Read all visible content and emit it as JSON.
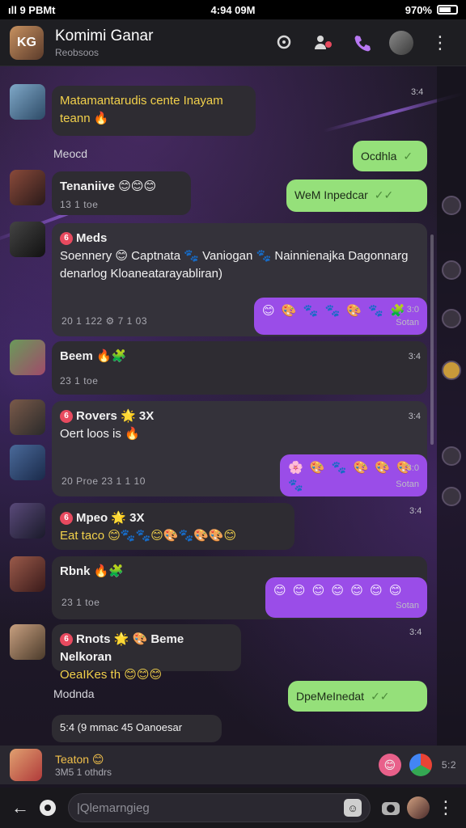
{
  "status": {
    "left": "ıll 9 PBMt",
    "time": "4:94 09M",
    "battery": "970%"
  },
  "header": {
    "title": "Komimi Ganar",
    "subtitle": "Reobsoos",
    "avatar_initials": "KG"
  },
  "messages": {
    "m1": {
      "text": "Matamantarudis cente Inayam",
      "text2": "teann 🔥",
      "time": "3:4"
    },
    "label1": "Meocd",
    "m2": {
      "text": "Ocdhla"
    },
    "m3": {
      "sender": "Tenaniive 😊😊😊",
      "meta": "13 1 toe"
    },
    "m4": {
      "text": "WeM Inpedcar"
    },
    "m5": {
      "sender": "Meds",
      "line1": "Soennery 😊 Captnata 🐾 Vaniogan 🐾 Nainnienajka Dagonnarg",
      "line2": "denarlog Kloaneatarayabliran)",
      "meta": "20 1 122   ⚙ 7 1 03"
    },
    "m6": {
      "emojis": "😊 🎨 🐾 🐾 🎨 🐾 🧩",
      "time": "3:0",
      "note": "Sotan"
    },
    "m7": {
      "sender": "Beem 🔥🧩",
      "meta": "23 1 toe",
      "time": "3:4"
    },
    "m8": {
      "sender": "Rovers 🌟 3X",
      "line1": "Oert loos is   🔥",
      "time": "3:4"
    },
    "m9": {
      "emojis": "🌸 🎨 🐾 🎨 🎨 🎨 🐾",
      "time": "3:0",
      "note": "Sotan",
      "meta": "20 Proe   23 1 1 10"
    },
    "m10": {
      "sender": "Mpeo 🌟 3X",
      "line1": "Eat taco 😊🐾🐾😊🎨🐾🎨🎨😊",
      "time": "3:4"
    },
    "m11": {
      "sender": "Rbnk 🔥🧩",
      "meta": "23 1 toe"
    },
    "m12": {
      "emojis": "😊 😊 😊 😊 😊 😊 😊",
      "note": "Sotan"
    },
    "m13": {
      "sender": "Rnots 🌟 🎨 Beme Nelkoran",
      "line1": "OeaIKes th 😊😊😊",
      "time": "3:4"
    },
    "label2": "Modnda",
    "m14": {
      "text": "DpeMeInedat"
    },
    "m15": {
      "text": "5:4 (9 mmac 45  Oanoesar"
    }
  },
  "preview": {
    "name": "Teaton 😊",
    "sub": "3M5 1 othdrs",
    "time": "5:2"
  },
  "composer": {
    "placeholder": "|Qlemarngieg"
  },
  "colors": {
    "accent_purple": "#9a4de8",
    "accent_green": "#95e07a",
    "phone": "#b878f2"
  },
  "icons": [
    "back-arrow-icon",
    "emoji-icon",
    "sticker-icon",
    "camera-icon",
    "more-vert-icon",
    "search-icon",
    "group-icon",
    "phone-icon"
  ]
}
